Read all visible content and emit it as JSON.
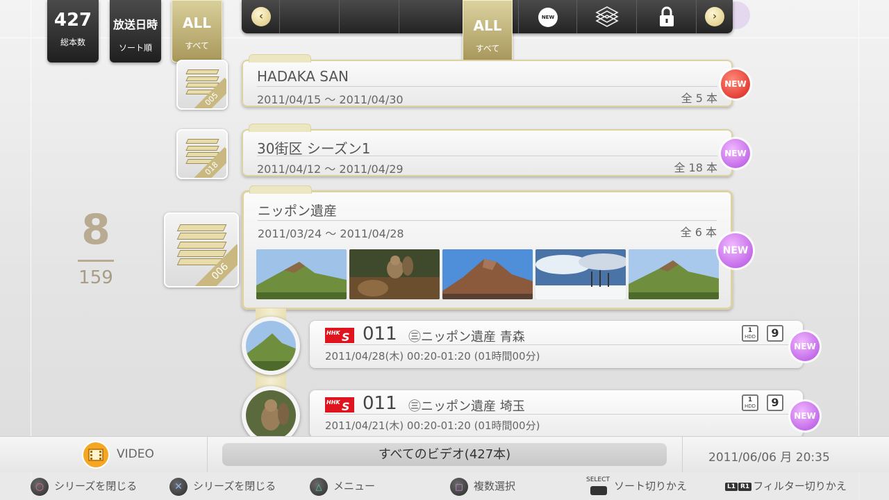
{
  "top_tiles": {
    "total": {
      "value": "427",
      "label": "総本数"
    },
    "sort": {
      "value": "放送日時",
      "label": "ソート順"
    },
    "filter": {
      "value": "ALL",
      "label": "すべて"
    }
  },
  "filter_bar": {
    "selected_value": "ALL",
    "selected_label": "すべて",
    "new_icon_text": "NEW"
  },
  "series": [
    {
      "title": "HADAKA SAN",
      "dates": "2011/04/15 ～ 2011/04/30",
      "count": "全 5 本",
      "number": "005",
      "badge": "NEW",
      "badge_color": "#d8201a"
    },
    {
      "title": "30街区 シーズン1",
      "dates": "2011/04/12 ～ 2011/04/29",
      "count": "全 18 本",
      "number": "018",
      "badge": "NEW",
      "badge_color": "#b24de0"
    },
    {
      "title": "ニッポン遺産",
      "dates": "2011/03/24 ～ 2011/04/28",
      "count": "全 6 本",
      "number": "006",
      "badge": "NEW",
      "badge_color": "#b24de0"
    }
  ],
  "episodes": [
    {
      "channel_logo": "HHK S",
      "channel": "011",
      "title": "㊂ニッポン遺産 青森",
      "datetime": "2011/04/28(木) 00:20-01:20 (01時間00分)",
      "storage": "HDD",
      "storage_num": "1",
      "extra": "9",
      "badge": "NEW"
    },
    {
      "channel_logo": "HHK S",
      "channel": "011",
      "title": "㊂ニッポン遺産 埼玉",
      "datetime": "2011/04/21(木) 00:20-01:20 (01時間00分)",
      "storage": "HDD",
      "storage_num": "1",
      "extra": "9",
      "badge": "NEW"
    }
  ],
  "counter": {
    "current": "8",
    "total": "159"
  },
  "status": {
    "app": "VIDEO",
    "category": "すべてのビデオ(427本)",
    "datetime": "2011/06/06 月 20:35"
  },
  "hints": [
    {
      "button": "circle",
      "label": "シリーズを閉じる"
    },
    {
      "button": "cross",
      "label": "シリーズを閉じる"
    },
    {
      "button": "triangle",
      "label": "メニュー"
    },
    {
      "button": "square",
      "label": "複数選択"
    },
    {
      "button": "SELECT",
      "label": "ソート切りかえ"
    },
    {
      "button": "L1R1",
      "label": "フィルター切りかえ"
    }
  ],
  "colors": {
    "accent_gold": "#c9b980",
    "new_red": "#d8201a",
    "new_purple": "#b24de0",
    "channel_red": "#e0141e"
  }
}
